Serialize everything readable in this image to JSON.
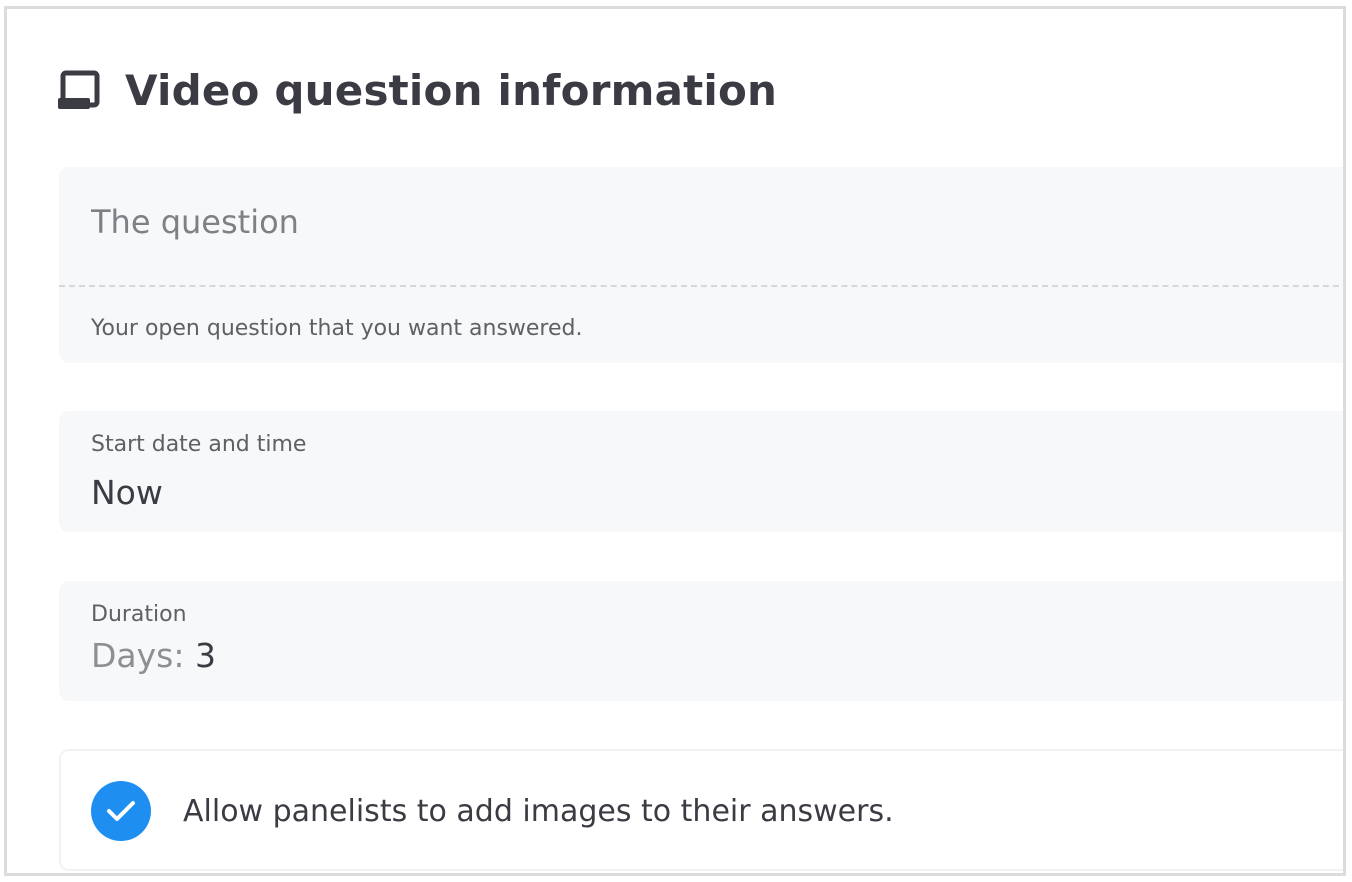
{
  "header": {
    "title": "Video question information",
    "icon": "laptop-icon"
  },
  "question": {
    "placeholder": "The question",
    "value": "",
    "hint": "Your open question that you want answered."
  },
  "start": {
    "label": "Start date and time",
    "value": "Now"
  },
  "duration": {
    "label": "Duration",
    "prefix": "Days: ",
    "days": "3"
  },
  "images_option": {
    "label": "Allow panelists to add images to their answers.",
    "checked": true,
    "check_color": "#1E8FF0",
    "icon": "checkmark-icon"
  },
  "colors": {
    "title": "#3B3B44",
    "card_background": "#F7F8F9",
    "frame_border": "#DCDCDC"
  }
}
